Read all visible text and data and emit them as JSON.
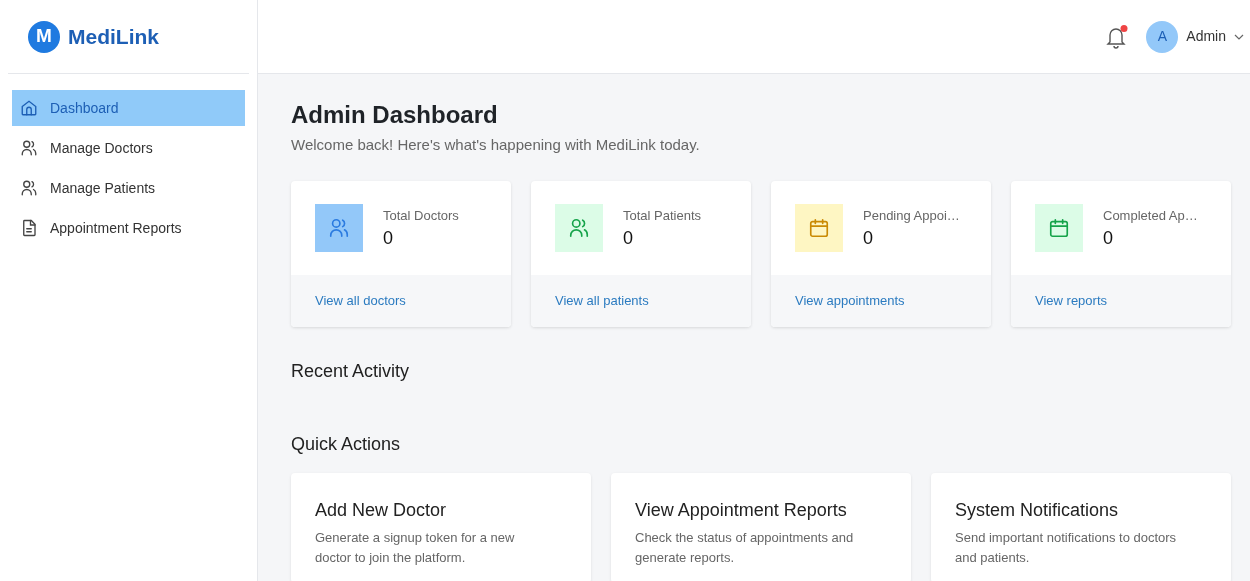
{
  "brand": {
    "logo_letter": "M",
    "name": "MediLink"
  },
  "sidebar": {
    "items": [
      {
        "label": "Dashboard",
        "kind": "home",
        "selected": true
      },
      {
        "label": "Manage Doctors",
        "kind": "users",
        "selected": false
      },
      {
        "label": "Manage Patients",
        "kind": "users",
        "selected": false
      },
      {
        "label": "Appointment Reports",
        "kind": "document",
        "selected": false
      }
    ]
  },
  "header": {
    "notifications": {
      "unread": true
    },
    "user": {
      "initial": "A",
      "name": "Admin"
    }
  },
  "page": {
    "title": "Admin Dashboard",
    "subtitle": "Welcome back! Here's what's happening with MediLink today."
  },
  "stats": [
    {
      "label": "Total Doctors",
      "value": "0",
      "kind": "users",
      "color": "#93c8f9",
      "link": "View all doctors"
    },
    {
      "label": "Total Patients",
      "value": "0",
      "kind": "users",
      "color": "#dcfce7",
      "link": "View all patients"
    },
    {
      "label": "Pending Appoi…",
      "value": "0",
      "kind": "calendar",
      "color": "#fef6c3",
      "link": "View appointments"
    },
    {
      "label": "Completed Ap…",
      "value": "0",
      "kind": "calendar",
      "color": "#dcfce7",
      "link": "View reports"
    }
  ],
  "recent_activity": {
    "title": "Recent Activity"
  },
  "quick_actions": {
    "title": "Quick Actions",
    "items": [
      {
        "title": "Add New Doctor",
        "description": "Generate a signup token for a new doctor to join the platform."
      },
      {
        "title": "View Appointment Reports",
        "description": "Check the status of appointments and generate reports."
      },
      {
        "title": "System Notifications",
        "description": "Send important notifications to doctors and patients."
      }
    ]
  }
}
